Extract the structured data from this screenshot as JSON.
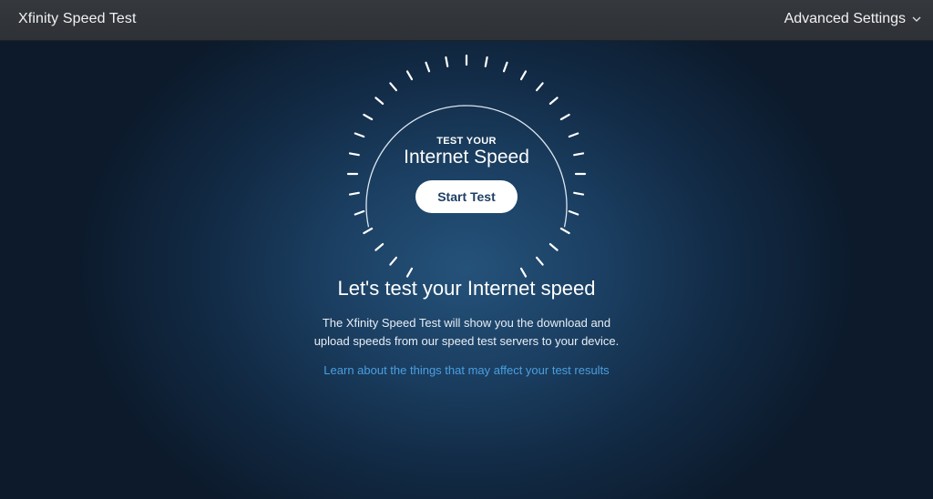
{
  "header": {
    "title": "Xfinity Speed Test",
    "advanced_settings": "Advanced Settings",
    "advanced_icon": "chevron-down-icon"
  },
  "gauge": {
    "subtitle": "TEST YOUR",
    "title": "Internet Speed",
    "start_label": "Start Test"
  },
  "content": {
    "headline": "Let's test your Internet speed",
    "description_line1": "The Xfinity Speed Test will show you the download and",
    "description_line2": "upload speeds from our speed test servers to your device.",
    "learn_link": "Learn about the things that may affect your test results"
  },
  "colors": {
    "link": "#4a9fe0",
    "button_text": "#1f3f66",
    "header_bg": "#333639"
  }
}
